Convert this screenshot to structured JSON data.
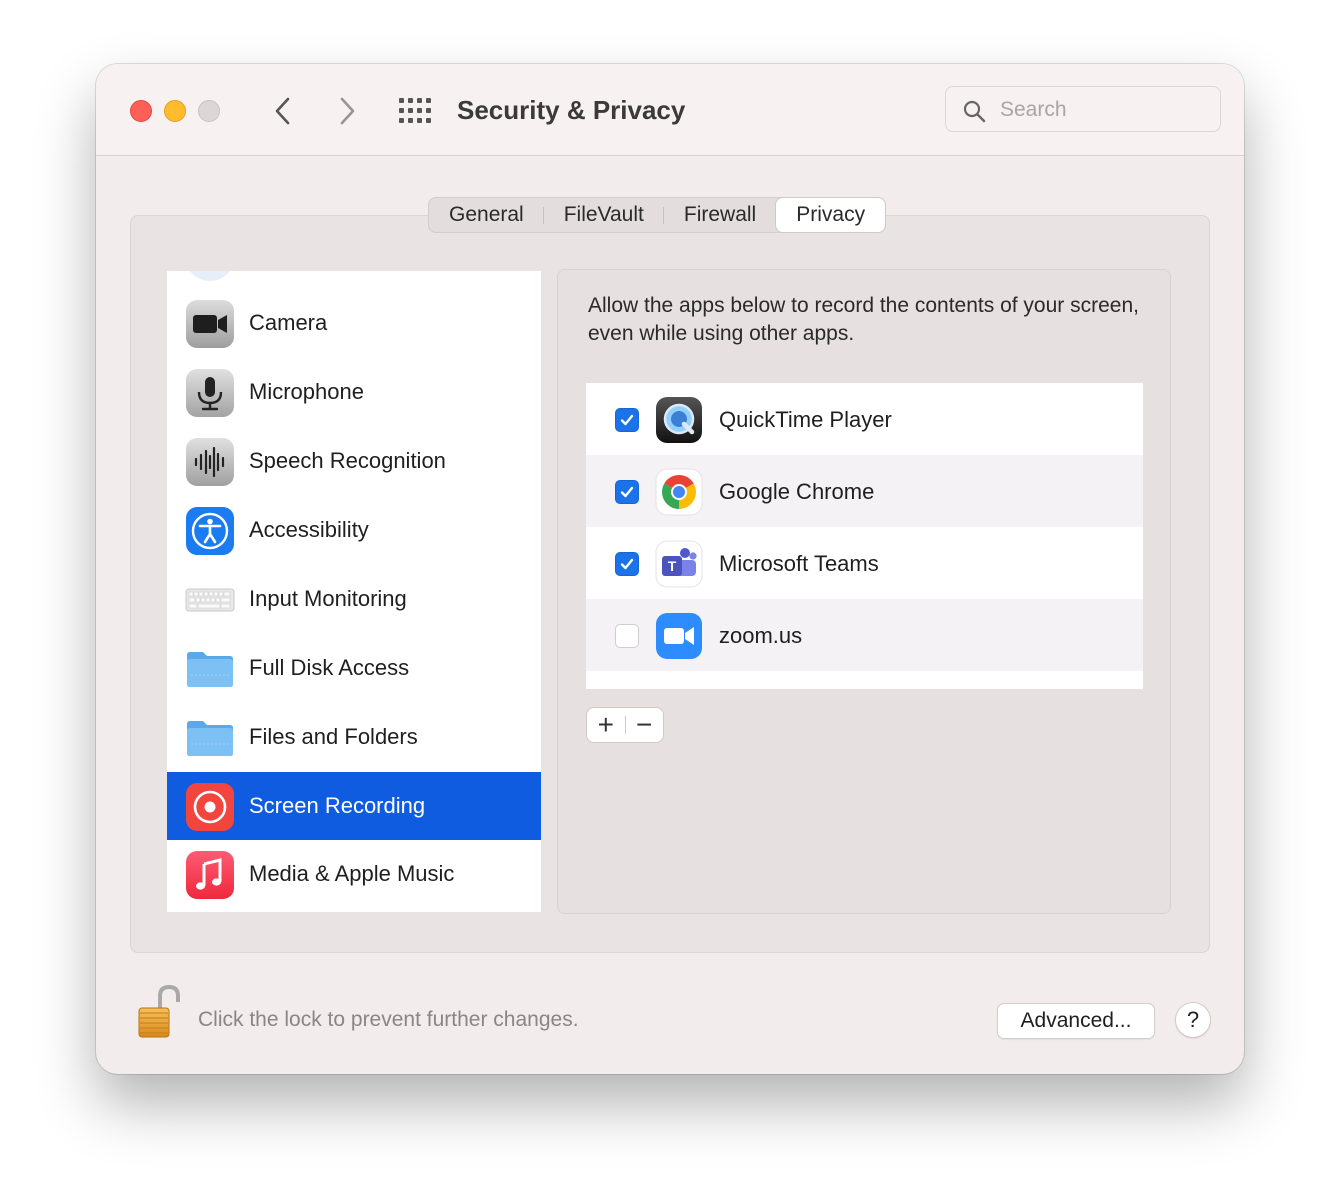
{
  "window": {
    "title": "Security & Privacy",
    "search_placeholder": "Search"
  },
  "tabs": [
    {
      "label": "General",
      "active": false
    },
    {
      "label": "FileVault",
      "active": false
    },
    {
      "label": "Firewall",
      "active": false
    },
    {
      "label": "Privacy",
      "active": true
    }
  ],
  "sidebar": {
    "items": [
      {
        "label": "Camera",
        "icon": "camera-icon"
      },
      {
        "label": "Microphone",
        "icon": "microphone-icon"
      },
      {
        "label": "Speech Recognition",
        "icon": "speech-recognition-icon"
      },
      {
        "label": "Accessibility",
        "icon": "accessibility-icon"
      },
      {
        "label": "Input Monitoring",
        "icon": "keyboard-icon"
      },
      {
        "label": "Full Disk Access",
        "icon": "folder-icon"
      },
      {
        "label": "Files and Folders",
        "icon": "folder-icon"
      },
      {
        "label": "Screen Recording",
        "icon": "screen-recording-icon",
        "selected": true
      },
      {
        "label": "Media & Apple Music",
        "icon": "music-icon"
      }
    ]
  },
  "panel": {
    "description": "Allow the apps below to record the contents of your screen, even while using other apps.",
    "apps": [
      {
        "name": "QuickTime Player",
        "checked": true,
        "icon": "quicktime-icon"
      },
      {
        "name": "Google Chrome",
        "checked": true,
        "icon": "chrome-icon"
      },
      {
        "name": "Microsoft Teams",
        "checked": true,
        "icon": "teams-icon"
      },
      {
        "name": "zoom.us",
        "checked": false,
        "icon": "zoom-icon"
      }
    ],
    "add_label": "+",
    "remove_label": "−"
  },
  "footer": {
    "lock_text": "Click the lock to prevent further changes.",
    "advanced_label": "Advanced...",
    "help_label": "?"
  },
  "colors": {
    "selection": "#0f5ce0",
    "checkbox": "#1a73e8",
    "window_bg": "#f2ecec"
  }
}
